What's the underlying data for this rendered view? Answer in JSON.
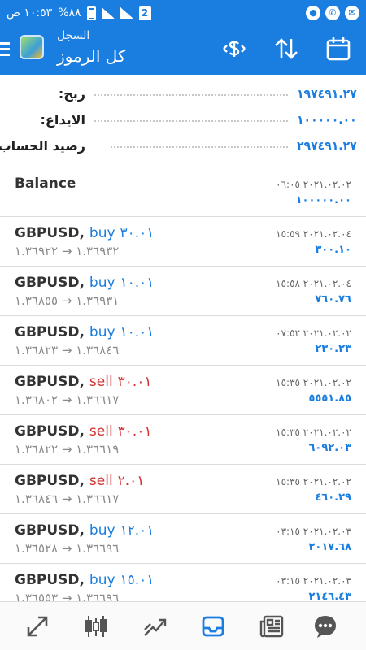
{
  "status": {
    "time": "١٠:٥٣ ص",
    "battery": "%٨٨"
  },
  "header": {
    "subtitle": "السجل",
    "title": "كل الرموز"
  },
  "summary": [
    {
      "label": "ربح:",
      "value": "١٩٧٤٩١.٢٧"
    },
    {
      "label": "الايداع:",
      "value": "١٠٠٠٠٠.٠٠"
    },
    {
      "label": "رصيد الحساب:",
      "value": "٢٩٧٤٩١.٢٧"
    }
  ],
  "balance": {
    "title": "Balance",
    "date": "٢٠٢١.٠٢.٠٢ ٠٦:٠٥",
    "value": "١٠٠٠٠٠.٠٠"
  },
  "trades": [
    {
      "symbol": "GBPUSD,",
      "side": "buy",
      "volume": "٣٠.٠١",
      "prices": "١.٣٦٩٣٢ → ١.٣٦٩٢٢",
      "date": "٢٠٢١.٠٢.٠٤ ١٥:٥٩",
      "profit": "٣٠٠.١٠"
    },
    {
      "symbol": "GBPUSD,",
      "side": "buy",
      "volume": "١٠.٠١",
      "prices": "١.٣٦٩٣١ → ١.٣٦٨٥٥",
      "date": "٢٠٢١.٠٢.٠٤ ١٥:٥٨",
      "profit": "٧٦٠.٧٦"
    },
    {
      "symbol": "GBPUSD,",
      "side": "buy",
      "volume": "١٠.٠١",
      "prices": "١.٣٦٨٤٦ → ١.٣٦٨٢٣",
      "date": "٢٠٢١.٠٢.٠٢ ٠٧:٥٢",
      "profit": "٢٣٠.٢٣"
    },
    {
      "symbol": "GBPUSD,",
      "side": "sell",
      "volume": "٣٠.٠١",
      "prices": "١.٣٦٦١٧ → ١.٣٦٨٠٢",
      "date": "٢٠٢١.٠٢.٠٢ ١٥:٣٥",
      "profit": "٥٥٥١.٨٥"
    },
    {
      "symbol": "GBPUSD,",
      "side": "sell",
      "volume": "٣٠.٠١",
      "prices": "١.٣٦٦١٩ → ١.٣٦٨٢٢",
      "date": "٢٠٢١.٠٢.٠٢ ١٥:٣٥",
      "profit": "٦٠٩٢.٠٣"
    },
    {
      "symbol": "GBPUSD,",
      "side": "sell",
      "volume": "٢.٠١",
      "prices": "١.٣٦٦١٧ → ١.٣٦٨٤٦",
      "date": "٢٠٢١.٠٢.٠٢ ١٥:٣٥",
      "profit": "٤٦٠.٢٩"
    },
    {
      "symbol": "GBPUSD,",
      "side": "buy",
      "volume": "١٢.٠١",
      "prices": "١.٣٦٦٩٦ → ١.٣٦٥٢٨",
      "date": "٢٠٢١.٠٢.٠٣ ٠٣:١٥",
      "profit": "٢٠١٧.٦٨"
    },
    {
      "symbol": "GBPUSD,",
      "side": "buy",
      "volume": "١٥.٠١",
      "prices": "١.٣٦٦٩٦ → ١.٣٦٥٥٣",
      "date": "٢٠٢١.٠٢.٠٣ ٠٣:١٥",
      "profit": "٢١٤٦.٤٣"
    }
  ],
  "colors": {
    "accent": "#1a7ee0",
    "buy": "#1a7ee0",
    "sell": "#d32f2f"
  },
  "nav_icons": [
    "quotes-icon",
    "chart-icon",
    "trade-icon",
    "history-icon",
    "news-icon",
    "chat-icon"
  ],
  "active_nav": "history-icon"
}
